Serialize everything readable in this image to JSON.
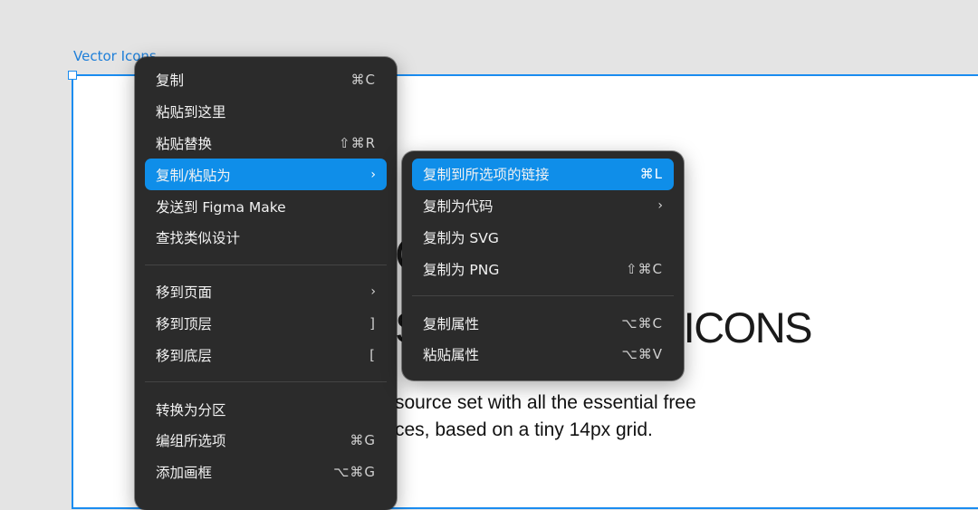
{
  "canvas": {
    "frame_label": "Vector Icons",
    "big_letter": "C",
    "heading_left": "S",
    "heading_right": "ICONS",
    "desc_line1": "source set with all the essential free",
    "desc_line2": "ces, based on a tiny 14px grid."
  },
  "main_menu": {
    "items": [
      {
        "label": "复制",
        "shortcut": "⌘C"
      },
      {
        "label": "粘贴到这里",
        "shortcut": ""
      },
      {
        "label": "粘贴替换",
        "shortcut": "⇧⌘R"
      },
      {
        "label": "复制/粘贴为",
        "shortcut": "›"
      },
      {
        "label": "发送到 Figma Make",
        "shortcut": ""
      },
      {
        "label": "查找类似设计",
        "shortcut": ""
      },
      {
        "label": "移到页面",
        "shortcut": "›"
      },
      {
        "label": "移到顶层",
        "shortcut": "]"
      },
      {
        "label": "移到底层",
        "shortcut": "["
      },
      {
        "label": "转换为分区",
        "shortcut": ""
      },
      {
        "label": "编组所选项",
        "shortcut": "⌘G"
      },
      {
        "label": "添加画框",
        "shortcut": "⌥⌘G"
      }
    ]
  },
  "sub_menu": {
    "items": [
      {
        "label": "复制到所选项的链接",
        "shortcut": "⌘L"
      },
      {
        "label": "复制为代码",
        "shortcut": "›"
      },
      {
        "label": "复制为 SVG",
        "shortcut": ""
      },
      {
        "label": "复制为 PNG",
        "shortcut": "⇧⌘C"
      },
      {
        "label": "复制属性",
        "shortcut": "⌥⌘C"
      },
      {
        "label": "粘贴属性",
        "shortcut": "⌥⌘V"
      }
    ]
  },
  "colors": {
    "accent": "#0f8ee9",
    "menu_bg": "#2b2b2b",
    "selection": "#1a8cf0"
  }
}
